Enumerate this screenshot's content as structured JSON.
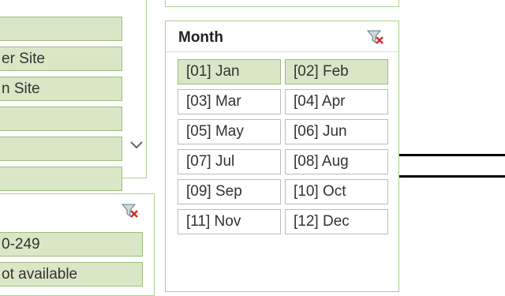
{
  "left_slicer_top": {
    "items": [
      {
        "label": "",
        "selected": true
      },
      {
        "label": "er Site",
        "selected": true
      },
      {
        "label": "n Site",
        "selected": true
      },
      {
        "label": "",
        "selected": true
      },
      {
        "label": "",
        "selected": true
      },
      {
        "label": "",
        "selected": true
      }
    ],
    "scroll_icon": "chevron-down-icon"
  },
  "left_slicer_bottom": {
    "clear_icon": "clear-filter-icon",
    "items": [
      {
        "label": "0-249",
        "selected": true
      },
      {
        "label": "ot available",
        "selected": true
      }
    ]
  },
  "month_slicer": {
    "title": "Month",
    "clear_icon": "clear-filter-icon",
    "items": [
      {
        "label": "[01] Jan",
        "selected": true
      },
      {
        "label": "[02] Feb",
        "selected": true
      },
      {
        "label": "[03] Mar",
        "selected": false
      },
      {
        "label": "[04] Apr",
        "selected": false
      },
      {
        "label": "[05] May",
        "selected": false
      },
      {
        "label": "[06] Jun",
        "selected": false
      },
      {
        "label": "[07] Jul",
        "selected": false
      },
      {
        "label": "[08] Aug",
        "selected": false
      },
      {
        "label": "[09] Sep",
        "selected": false
      },
      {
        "label": "[10] Oct",
        "selected": false
      },
      {
        "label": "[11] Nov",
        "selected": false
      },
      {
        "label": "[12] Dec",
        "selected": false
      }
    ]
  },
  "colors": {
    "selected_fill": "#d9e7c7",
    "selected_border": "#9dbe7d",
    "slicer_border": "#a9cf8e",
    "item_border": "#bcbcbc"
  }
}
